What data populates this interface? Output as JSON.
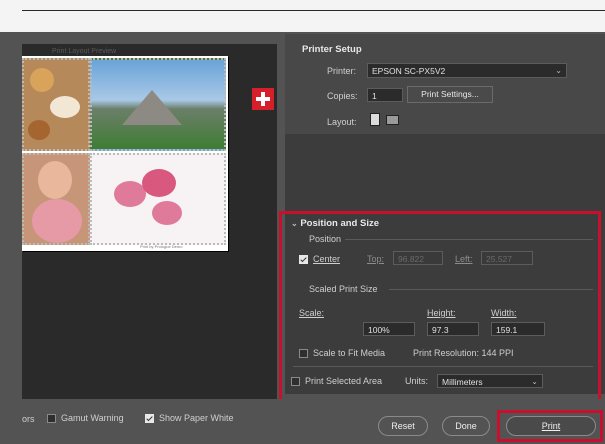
{
  "preview": {
    "caption": "Print Layout Preview",
    "credit": "Print by Prologue Demo"
  },
  "printer_setup": {
    "title": "Printer Setup",
    "printer_label": "Printer:",
    "printer_value": "EPSON SC-PX5V2",
    "copies_label": "Copies:",
    "copies_value": "1",
    "print_settings_label": "Print Settings...",
    "layout_label": "Layout:"
  },
  "position_size": {
    "title": "Position and Size",
    "position_label": "Position",
    "center_label": "Center",
    "center_checked": true,
    "top_label": "Top:",
    "top_value": "96.822",
    "left_label": "Left:",
    "left_value": "25.527",
    "scaled_label": "Scaled Print Size",
    "scale_label": "Scale:",
    "height_label": "Height:",
    "width_label": "Width:",
    "scale_value": "100%",
    "height_value": "97.3",
    "width_value": "159.1",
    "fit_media_label": "Scale to Fit Media",
    "fit_media_checked": false,
    "resolution_text": "Print Resolution: 144 PPI",
    "print_selected_label": "Print Selected Area",
    "print_selected_checked": false,
    "units_label": "Units:",
    "units_value": "Millimeters"
  },
  "bottom": {
    "colors_label": "ors",
    "gamut_label": "Gamut Warning",
    "gamut_checked": false,
    "paper_white_label": "Show Paper White",
    "paper_white_checked": true,
    "reset_label": "Reset",
    "done_label": "Done",
    "print_label": "Print"
  },
  "colors": {
    "accent": "#c8102e"
  }
}
